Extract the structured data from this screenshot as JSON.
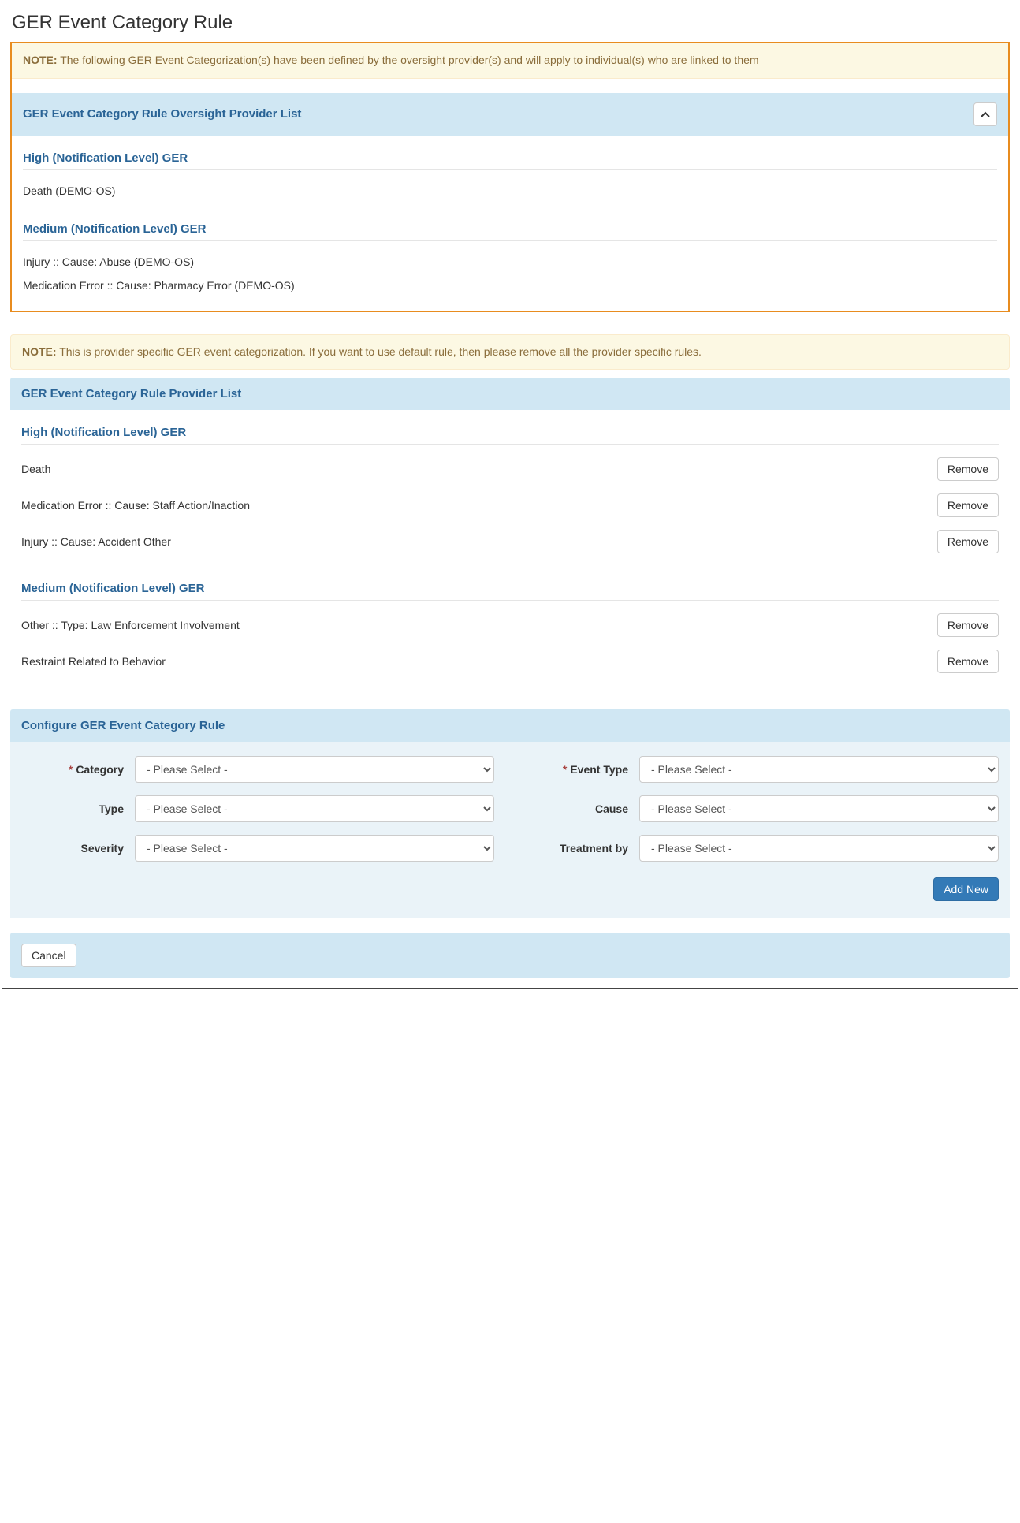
{
  "page_title": "GER Event Category Rule",
  "note1_label": "NOTE:",
  "note1_text": "The following GER Event Categorization(s) have been defined by the oversight provider(s) and will apply to individual(s) who are linked to them",
  "oversight_list": {
    "heading": "GER Event Category Rule Oversight Provider List",
    "levels": [
      {
        "title": "High (Notification Level) GER",
        "items": [
          "Death (DEMO-OS)"
        ]
      },
      {
        "title": "Medium (Notification Level) GER",
        "items": [
          "Injury :: Cause: Abuse (DEMO-OS)",
          "Medication Error :: Cause: Pharmacy Error (DEMO-OS)"
        ]
      }
    ]
  },
  "note2_label": "NOTE:",
  "note2_text": "This is provider specific GER event categorization. If you want to use default rule, then please remove all the provider specific rules.",
  "provider_list": {
    "heading": "GER Event Category Rule Provider List",
    "remove_label": "Remove",
    "levels": [
      {
        "title": "High (Notification Level) GER",
        "items": [
          "Death",
          "Medication Error :: Cause: Staff Action/Inaction",
          "Injury :: Cause: Accident Other"
        ]
      },
      {
        "title": "Medium (Notification Level) GER",
        "items": [
          "Other :: Type: Law Enforcement Involvement",
          "Restraint Related to Behavior"
        ]
      }
    ]
  },
  "configure": {
    "heading": "Configure GER Event Category Rule",
    "fields": {
      "category": {
        "label": "Category",
        "value": "- Please Select -"
      },
      "event_type": {
        "label": "Event Type",
        "value": "- Please Select -"
      },
      "type": {
        "label": "Type",
        "value": "- Please Select -"
      },
      "cause": {
        "label": "Cause",
        "value": "- Please Select -"
      },
      "severity": {
        "label": "Severity",
        "value": "- Please Select -"
      },
      "treatment_by": {
        "label": "Treatment by",
        "value": "- Please Select -"
      }
    },
    "add_new_label": "Add New"
  },
  "cancel_label": "Cancel"
}
